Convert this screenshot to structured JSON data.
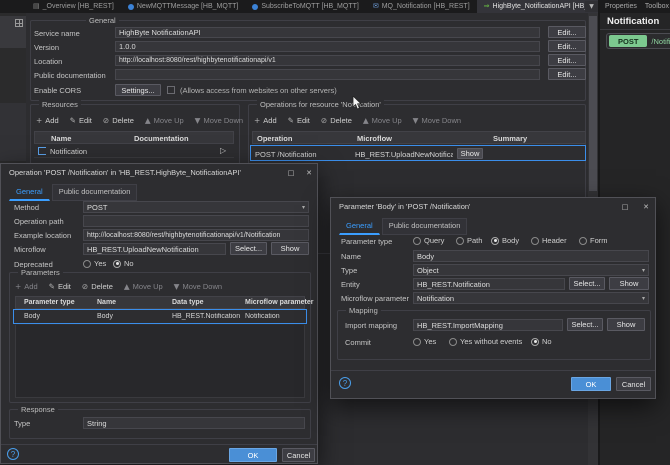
{
  "tab_bar": {
    "tabs": [
      {
        "label": "_Overview [HB_REST]"
      },
      {
        "label": "NewMQTTMessage [HB_MQTT]"
      },
      {
        "label": "SubscribeToMQTT [HB_MQTT]"
      },
      {
        "label": "MQ_Notification [HB_REST]"
      },
      {
        "label": "HighByte_NotificationAPI [HB_REST]"
      }
    ],
    "close_glyph": "✕",
    "overflow_glyph": "▼"
  },
  "side_panel": {
    "tabs": [
      "Properties",
      "Toolbox"
    ],
    "title": "Notification",
    "method": "POST",
    "path": "/Notification"
  },
  "editor": {
    "general": {
      "legend": "General",
      "rows": [
        {
          "label": "Service name",
          "value": "HighByte NotificationAPI",
          "button": "Edit..."
        },
        {
          "label": "Version",
          "value": "1.0.0",
          "button": "Edit..."
        },
        {
          "label": "Location",
          "value": "http://localhost:8080/rest/highbytenotificationapi/v1",
          "button": "Edit..."
        },
        {
          "label": "Public documentation",
          "value": "",
          "button": "Edit..."
        }
      ],
      "cors": {
        "label": "Enable CORS",
        "button": "Settings...",
        "note": "(Allows access from websites on other servers)"
      }
    },
    "resources": {
      "legend": "Resources",
      "toolbar": [
        {
          "glyph": "+",
          "label": "Add"
        },
        {
          "glyph": "✎",
          "label": "Edit"
        },
        {
          "glyph": "⊘",
          "label": "Delete"
        },
        {
          "glyph": "▲",
          "label": "Move Up"
        },
        {
          "glyph": "▼",
          "label": "Move Down"
        }
      ],
      "columns": [
        "Name",
        "Documentation"
      ],
      "rows": [
        {
          "name": "Notification",
          "documentation": "",
          "expand_glyph": "▷"
        }
      ]
    },
    "operations": {
      "legend": "Operations for resource 'Notification'",
      "toolbar": [
        {
          "glyph": "+",
          "label": "Add"
        },
        {
          "glyph": "✎",
          "label": "Edit"
        },
        {
          "glyph": "⊘",
          "label": "Delete"
        },
        {
          "glyph": "▲",
          "label": "Move Up"
        },
        {
          "glyph": "▼",
          "label": "Move Down"
        }
      ],
      "columns": [
        "Operation",
        "Microflow",
        "Summary"
      ],
      "rows": [
        {
          "operation": "POST /Notification",
          "microflow": "HB_REST.UploadNewNotification",
          "show_button": "Show",
          "summary": ""
        }
      ]
    }
  },
  "operation_dialog": {
    "title": "Operation 'POST /Notification' in 'HB_REST.HighByte_NotificationAPI'",
    "maximize_glyph": "□",
    "close_glyph": "✕",
    "tabs": [
      "General",
      "Public documentation"
    ],
    "method": {
      "label": "Method",
      "value": "POST"
    },
    "operation_path": {
      "label": "Operation path",
      "value": ""
    },
    "example_location": {
      "label": "Example location",
      "value": "http://localhost:8080/rest/highbytenotificationapi/v1/Notification"
    },
    "microflow": {
      "label": "Microflow",
      "value": "HB_REST.UploadNewNotification",
      "select_button": "Select...",
      "show_button": "Show"
    },
    "deprecated": {
      "label": "Deprecated",
      "options": [
        "Yes",
        "No"
      ],
      "selected": "No"
    },
    "parameters": {
      "legend": "Parameters",
      "toolbar": [
        {
          "glyph": "+",
          "label": "Add"
        },
        {
          "glyph": "✎",
          "label": "Edit"
        },
        {
          "glyph": "⊘",
          "label": "Delete"
        },
        {
          "glyph": "▲",
          "label": "Move Up"
        },
        {
          "glyph": "▼",
          "label": "Move Down"
        }
      ],
      "columns": [
        "Parameter type",
        "Name",
        "Data type",
        "Microflow parameter"
      ],
      "rows": [
        {
          "parameter_type": "Body",
          "name": "Body",
          "data_type": "HB_REST.Notification (Im...",
          "microflow_parameter": "Notification"
        }
      ]
    },
    "response": {
      "legend": "Response",
      "type_label": "Type",
      "type_value": "String"
    },
    "help_glyph": "?",
    "ok_button": "OK",
    "cancel_button": "Cancel"
  },
  "parameter_dialog": {
    "title": "Parameter 'Body' in 'POST /Notification'",
    "maximize_glyph": "□",
    "close_glyph": "✕",
    "tabs": [
      "General",
      "Public documentation"
    ],
    "parameter_type": {
      "label": "Parameter type",
      "options": [
        "Query",
        "Path",
        "Body",
        "Header",
        "Form"
      ],
      "selected": "Body"
    },
    "name": {
      "label": "Name",
      "value": "Body"
    },
    "type": {
      "label": "Type",
      "value": "Object"
    },
    "entity": {
      "label": "Entity",
      "value": "HB_REST.Notification",
      "select_button": "Select...",
      "show_button": "Show"
    },
    "microflow_parameter": {
      "label": "Microflow parameter",
      "value": "Notification"
    },
    "mapping": {
      "legend": "Mapping",
      "import_mapping": {
        "label": "Import mapping",
        "value": "HB_REST.ImportMapping",
        "select_button": "Select...",
        "show_button": "Show"
      },
      "commit": {
        "label": "Commit",
        "options": [
          "Yes",
          "Yes without events",
          "No"
        ],
        "selected": "No"
      }
    },
    "help_glyph": "?",
    "ok_button": "OK",
    "cancel_button": "Cancel"
  },
  "colors": {
    "accent_blue": "#3b8eea",
    "ok_button_blue": "#4a8fd6",
    "badge_green": "#7cc98f",
    "selection_border": "#3b8eea"
  }
}
